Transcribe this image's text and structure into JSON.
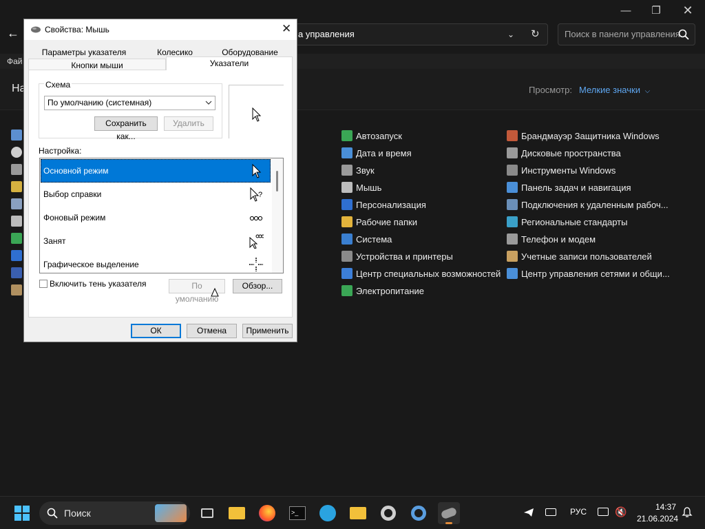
{
  "control_panel": {
    "address_text": "а управления",
    "search_placeholder": "Поиск в панели управления",
    "menu_file_partial": "Фай",
    "header_partial": "На",
    "view_label": "Просмотр:",
    "view_value": "Мелкие значки",
    "column1": [
      {
        "label": "Автозапуск",
        "icon": "autoplay-icon",
        "color": "#3aa655"
      },
      {
        "label": "Дата и время",
        "icon": "clock-icon",
        "color": "#4a8fd8"
      },
      {
        "label": "Звук",
        "icon": "speaker-icon",
        "color": "#9a9a9a"
      },
      {
        "label": "Мышь",
        "icon": "mouse-icon",
        "color": "#bdbdbd"
      },
      {
        "label": "Персонализация",
        "icon": "personalization-icon",
        "color": "#2f6fd0"
      },
      {
        "label": "Рабочие папки",
        "icon": "work-folders-icon",
        "color": "#e2b33c"
      },
      {
        "label": "Система",
        "icon": "system-icon",
        "color": "#3a7fd0"
      },
      {
        "label": "Устройства и принтеры",
        "icon": "printer-icon",
        "color": "#8a8a8a"
      },
      {
        "label": "Центр специальных возможностей",
        "icon": "accessibility-icon",
        "color": "#3c7fd8"
      },
      {
        "label": "Электропитание",
        "icon": "power-icon",
        "color": "#3aa655"
      }
    ],
    "column2": [
      {
        "label": "Брандмауэр Защитника Windows",
        "icon": "firewall-icon",
        "color": "#c2593a"
      },
      {
        "label": "Дисковые пространства",
        "icon": "storage-spaces-icon",
        "color": "#9a9a9a"
      },
      {
        "label": "Инструменты Windows",
        "icon": "tools-icon",
        "color": "#8a8a8a"
      },
      {
        "label": "Панель задач и навигация",
        "icon": "taskbar-icon",
        "color": "#4a8fd8"
      },
      {
        "label": "Подключения к удаленным рабоч...",
        "icon": "remote-desktop-icon",
        "color": "#6a8fb8"
      },
      {
        "label": "Региональные стандарты",
        "icon": "region-icon",
        "color": "#3aa0c8"
      },
      {
        "label": "Телефон и модем",
        "icon": "phone-modem-icon",
        "color": "#9a9a9a"
      },
      {
        "label": "Учетные записи пользователей",
        "icon": "user-accounts-icon",
        "color": "#c8a060"
      },
      {
        "label": "Центр управления сетями и общи...",
        "icon": "network-icon",
        "color": "#4a8fd8"
      }
    ]
  },
  "dialog": {
    "title": "Свойства: Мышь",
    "tabs_top": [
      "Параметры указателя",
      "Колесико",
      "Оборудование"
    ],
    "tabs_bottom": [
      "Кнопки мыши",
      "Указатели"
    ],
    "scheme_label": "Схема",
    "scheme_value": "По умолчанию (системная)",
    "save_as": "Сохранить как...",
    "delete": "Удалить",
    "customize_label": "Настройка:",
    "cursor_rows": [
      {
        "label": "Основной режим",
        "icon": "arrow-cursor-icon"
      },
      {
        "label": "Выбор справки",
        "icon": "help-cursor-icon"
      },
      {
        "label": "Фоновый режим",
        "icon": "working-cursor-icon"
      },
      {
        "label": "Занят",
        "icon": "busy-cursor-icon"
      },
      {
        "label": "Графическое выделение",
        "icon": "precision-cursor-icon"
      }
    ],
    "shadow_checkbox": "Включить тень указателя",
    "use_default": "По умолчанию",
    "browse": "Обзор...",
    "ok": "ОК",
    "cancel": "Отмена",
    "apply": "Применить"
  },
  "taskbar": {
    "search_label": "Поиск",
    "language": "РУС",
    "time": "14:37",
    "date": "21.06.2024"
  }
}
